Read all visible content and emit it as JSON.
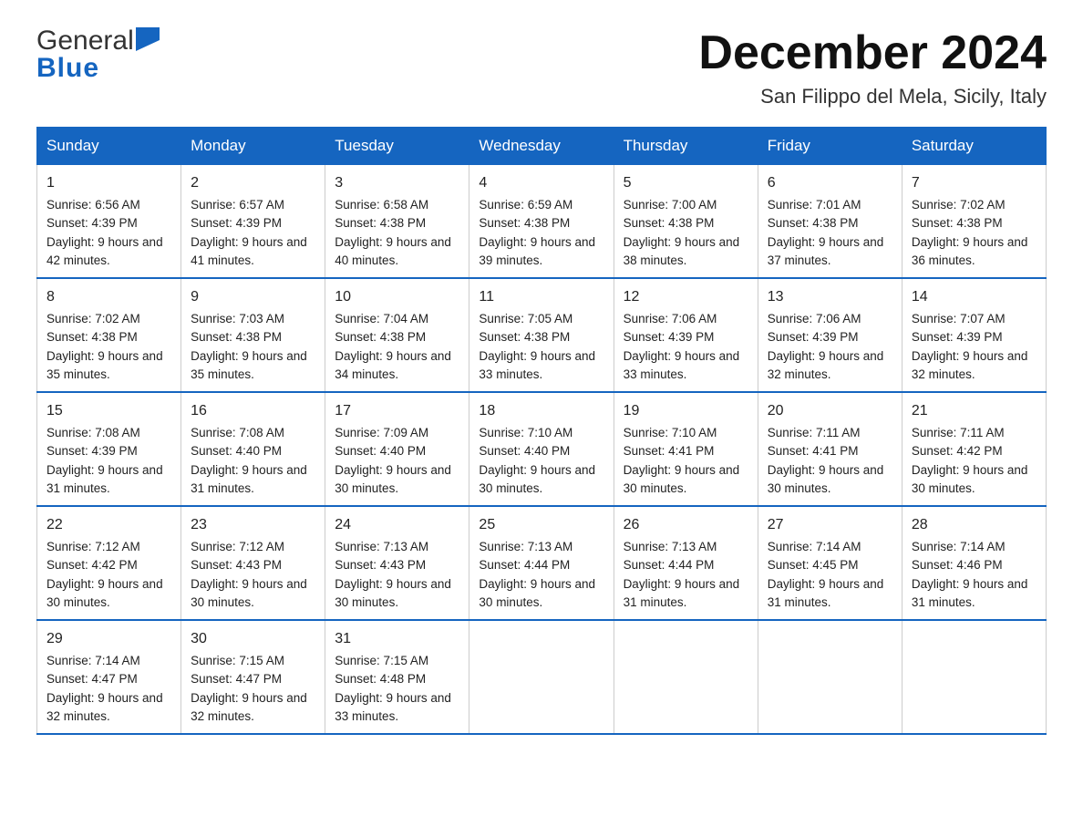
{
  "header": {
    "logo_general": "General",
    "logo_blue": "Blue",
    "month_title": "December 2024",
    "subtitle": "San Filippo del Mela, Sicily, Italy"
  },
  "days_of_week": [
    "Sunday",
    "Monday",
    "Tuesday",
    "Wednesday",
    "Thursday",
    "Friday",
    "Saturday"
  ],
  "weeks": [
    [
      {
        "day": "1",
        "sunrise": "6:56 AM",
        "sunset": "4:39 PM",
        "daylight": "9 hours and 42 minutes."
      },
      {
        "day": "2",
        "sunrise": "6:57 AM",
        "sunset": "4:39 PM",
        "daylight": "9 hours and 41 minutes."
      },
      {
        "day": "3",
        "sunrise": "6:58 AM",
        "sunset": "4:38 PM",
        "daylight": "9 hours and 40 minutes."
      },
      {
        "day": "4",
        "sunrise": "6:59 AM",
        "sunset": "4:38 PM",
        "daylight": "9 hours and 39 minutes."
      },
      {
        "day": "5",
        "sunrise": "7:00 AM",
        "sunset": "4:38 PM",
        "daylight": "9 hours and 38 minutes."
      },
      {
        "day": "6",
        "sunrise": "7:01 AM",
        "sunset": "4:38 PM",
        "daylight": "9 hours and 37 minutes."
      },
      {
        "day": "7",
        "sunrise": "7:02 AM",
        "sunset": "4:38 PM",
        "daylight": "9 hours and 36 minutes."
      }
    ],
    [
      {
        "day": "8",
        "sunrise": "7:02 AM",
        "sunset": "4:38 PM",
        "daylight": "9 hours and 35 minutes."
      },
      {
        "day": "9",
        "sunrise": "7:03 AM",
        "sunset": "4:38 PM",
        "daylight": "9 hours and 35 minutes."
      },
      {
        "day": "10",
        "sunrise": "7:04 AM",
        "sunset": "4:38 PM",
        "daylight": "9 hours and 34 minutes."
      },
      {
        "day": "11",
        "sunrise": "7:05 AM",
        "sunset": "4:38 PM",
        "daylight": "9 hours and 33 minutes."
      },
      {
        "day": "12",
        "sunrise": "7:06 AM",
        "sunset": "4:39 PM",
        "daylight": "9 hours and 33 minutes."
      },
      {
        "day": "13",
        "sunrise": "7:06 AM",
        "sunset": "4:39 PM",
        "daylight": "9 hours and 32 minutes."
      },
      {
        "day": "14",
        "sunrise": "7:07 AM",
        "sunset": "4:39 PM",
        "daylight": "9 hours and 32 minutes."
      }
    ],
    [
      {
        "day": "15",
        "sunrise": "7:08 AM",
        "sunset": "4:39 PM",
        "daylight": "9 hours and 31 minutes."
      },
      {
        "day": "16",
        "sunrise": "7:08 AM",
        "sunset": "4:40 PM",
        "daylight": "9 hours and 31 minutes."
      },
      {
        "day": "17",
        "sunrise": "7:09 AM",
        "sunset": "4:40 PM",
        "daylight": "9 hours and 30 minutes."
      },
      {
        "day": "18",
        "sunrise": "7:10 AM",
        "sunset": "4:40 PM",
        "daylight": "9 hours and 30 minutes."
      },
      {
        "day": "19",
        "sunrise": "7:10 AM",
        "sunset": "4:41 PM",
        "daylight": "9 hours and 30 minutes."
      },
      {
        "day": "20",
        "sunrise": "7:11 AM",
        "sunset": "4:41 PM",
        "daylight": "9 hours and 30 minutes."
      },
      {
        "day": "21",
        "sunrise": "7:11 AM",
        "sunset": "4:42 PM",
        "daylight": "9 hours and 30 minutes."
      }
    ],
    [
      {
        "day": "22",
        "sunrise": "7:12 AM",
        "sunset": "4:42 PM",
        "daylight": "9 hours and 30 minutes."
      },
      {
        "day": "23",
        "sunrise": "7:12 AM",
        "sunset": "4:43 PM",
        "daylight": "9 hours and 30 minutes."
      },
      {
        "day": "24",
        "sunrise": "7:13 AM",
        "sunset": "4:43 PM",
        "daylight": "9 hours and 30 minutes."
      },
      {
        "day": "25",
        "sunrise": "7:13 AM",
        "sunset": "4:44 PM",
        "daylight": "9 hours and 30 minutes."
      },
      {
        "day": "26",
        "sunrise": "7:13 AM",
        "sunset": "4:44 PM",
        "daylight": "9 hours and 31 minutes."
      },
      {
        "day": "27",
        "sunrise": "7:14 AM",
        "sunset": "4:45 PM",
        "daylight": "9 hours and 31 minutes."
      },
      {
        "day": "28",
        "sunrise": "7:14 AM",
        "sunset": "4:46 PM",
        "daylight": "9 hours and 31 minutes."
      }
    ],
    [
      {
        "day": "29",
        "sunrise": "7:14 AM",
        "sunset": "4:47 PM",
        "daylight": "9 hours and 32 minutes."
      },
      {
        "day": "30",
        "sunrise": "7:15 AM",
        "sunset": "4:47 PM",
        "daylight": "9 hours and 32 minutes."
      },
      {
        "day": "31",
        "sunrise": "7:15 AM",
        "sunset": "4:48 PM",
        "daylight": "9 hours and 33 minutes."
      },
      null,
      null,
      null,
      null
    ]
  ],
  "labels": {
    "sunrise": "Sunrise:",
    "sunset": "Sunset:",
    "daylight": "Daylight:"
  }
}
